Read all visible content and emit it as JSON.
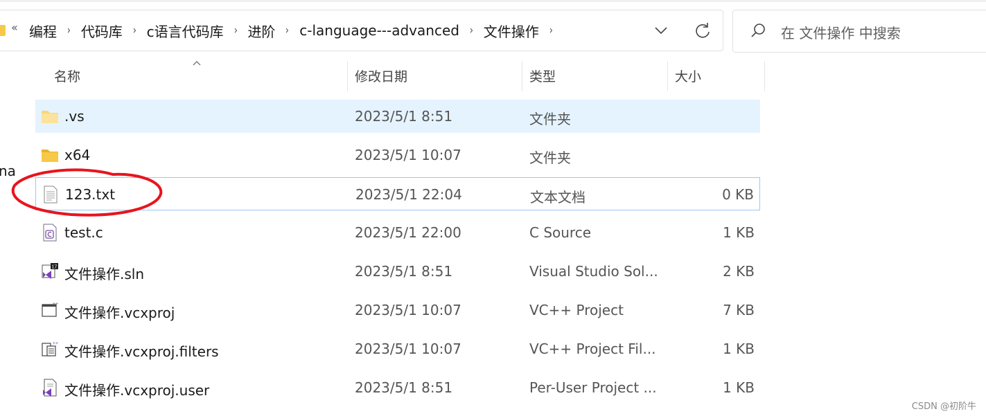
{
  "address_bar": {
    "breadcrumbs": [
      "编程",
      "代码库",
      "c语言代码库",
      "进阶",
      "c-language---advanced",
      "文件操作"
    ],
    "first_chevron": "«",
    "separator": "›"
  },
  "search": {
    "placeholder": "在 文件操作 中搜索"
  },
  "left_stub_text": "na",
  "columns": {
    "name": "名称",
    "modified": "修改日期",
    "type": "类型",
    "size": "大小"
  },
  "files": [
    {
      "name": ".vs",
      "modified": "2023/5/1 8:51",
      "type": "文件夹",
      "size": "",
      "icon": "folder-icon"
    },
    {
      "name": "x64",
      "modified": "2023/5/1 10:07",
      "type": "文件夹",
      "size": "",
      "icon": "folder-icon"
    },
    {
      "name": "123.txt",
      "modified": "2023/5/1 22:04",
      "type": "文本文档",
      "size": "0 KB",
      "icon": "text-file-icon"
    },
    {
      "name": "test.c",
      "modified": "2023/5/1 22:00",
      "type": "C Source",
      "size": "1 KB",
      "icon": "c-source-icon"
    },
    {
      "name": "文件操作.sln",
      "modified": "2023/5/1 8:51",
      "type": "Visual Studio Sol...",
      "size": "2 KB",
      "icon": "vs-solution-icon"
    },
    {
      "name": "文件操作.vcxproj",
      "modified": "2023/5/1 10:07",
      "type": "VC++ Project",
      "size": "7 KB",
      "icon": "vcxproj-icon"
    },
    {
      "name": "文件操作.vcxproj.filters",
      "modified": "2023/5/1 10:07",
      "type": "VC++ Project Fil...",
      "size": "1 KB",
      "icon": "vcxproj-filters-icon"
    },
    {
      "name": "文件操作.vcxproj.user",
      "modified": "2023/5/1 8:51",
      "type": "Per-User Project ...",
      "size": "1 KB",
      "icon": "vcxproj-user-icon"
    }
  ],
  "watermark": "CSDN @初阶牛",
  "colors": {
    "accent_select": "#e5f3ff",
    "focus_border": "#99c9ef",
    "annotation_red": "#e8141d",
    "folder_yellow": "#f7c948"
  }
}
